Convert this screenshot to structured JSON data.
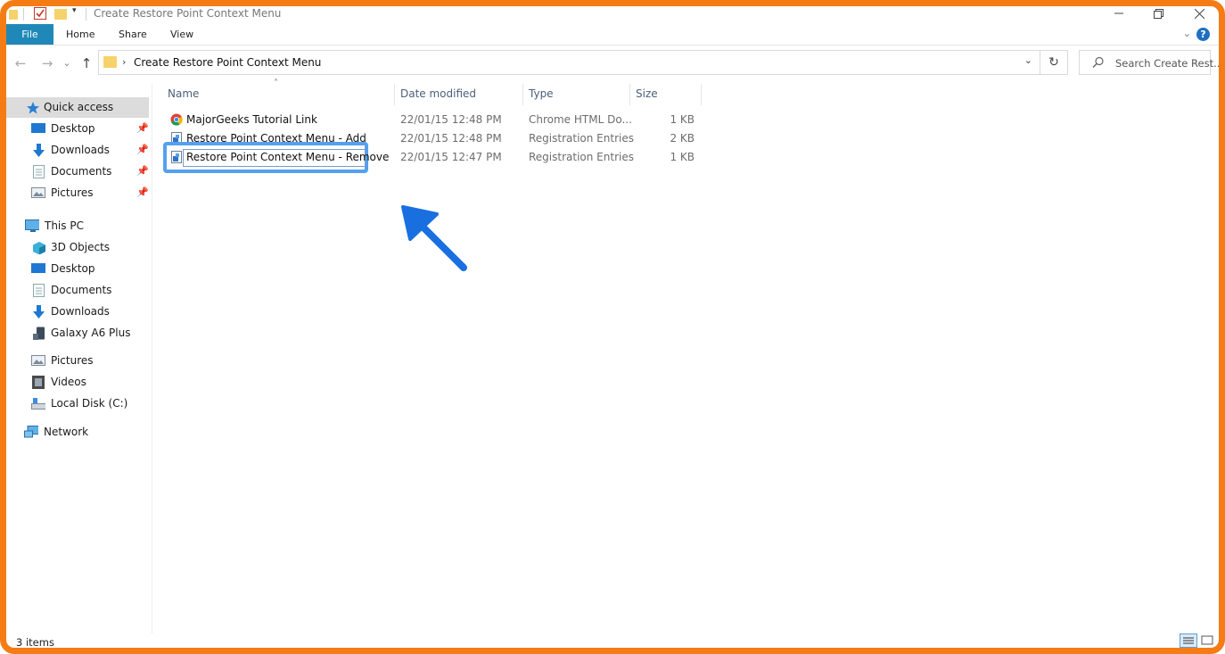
{
  "window": {
    "title": "Create Restore Point Context Menu"
  },
  "ribbon": {
    "tabs": [
      "File",
      "Home",
      "Share",
      "View"
    ],
    "help_label": "?"
  },
  "address_bar": {
    "path": "Create Restore Point Context Menu"
  },
  "search": {
    "placeholder": "Search Create Rest..."
  },
  "sidebar": {
    "quick_access": "Quick access",
    "quick_items": [
      "Desktop",
      "Downloads",
      "Documents",
      "Pictures"
    ],
    "this_pc": "This PC",
    "pc_items": [
      "3D Objects",
      "Desktop",
      "Documents",
      "Downloads",
      "Galaxy A6 Plus",
      "Pictures",
      "Videos",
      "Local Disk (C:)"
    ],
    "network": "Network"
  },
  "file_list": {
    "columns": [
      "Name",
      "Date modified",
      "Type",
      "Size"
    ],
    "rows": [
      {
        "name": "MajorGeeks Tutorial Link",
        "date": "22/01/15 12:48 PM",
        "type": "Chrome HTML Do...",
        "size": "1 KB",
        "icon": "chrome-icon"
      },
      {
        "name": "Restore Point Context Menu - Add",
        "date": "22/01/15 12:48 PM",
        "type": "Registration Entries",
        "size": "2 KB",
        "icon": "registry-file-icon"
      },
      {
        "name": "Restore Point Context Menu - Remove",
        "date": "22/01/15 12:47 PM",
        "type": "Registration Entries",
        "size": "1 KB",
        "icon": "registry-file-icon"
      }
    ]
  },
  "status": {
    "item_count": "3 items"
  },
  "colors": {
    "frame": "#f57c14",
    "file_tab": "#1f88b8",
    "highlight": "#56a0ee",
    "arrow": "#1a6fe0"
  }
}
